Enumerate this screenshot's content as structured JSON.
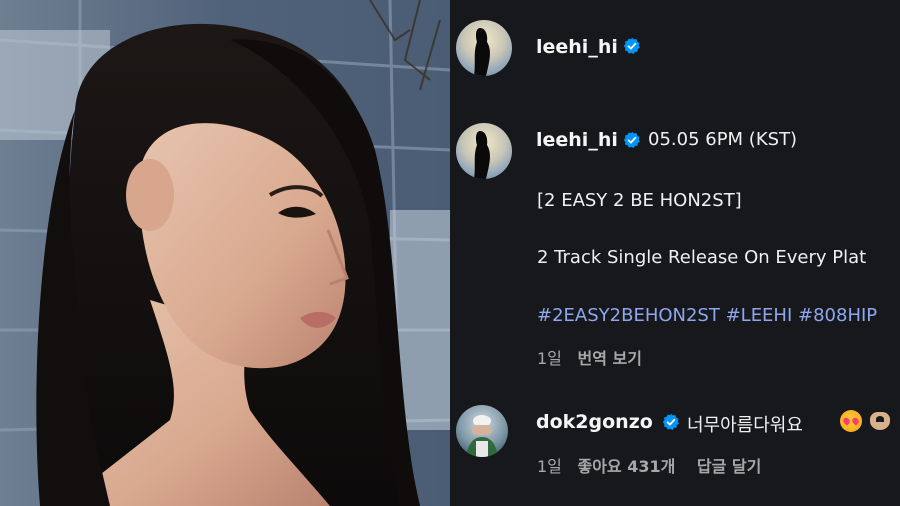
{
  "post": {
    "author": "leehi_hi",
    "caption_author": "leehi_hi",
    "release_info": "05.05 6PM (KST)",
    "title_line": "[2 EASY 2 BE HON2ST]",
    "description": "2 Track Single Release On Every Plat",
    "hashtags": "#2EASY2BEHON2ST #LEEHI #808HIP",
    "time_ago": "1일",
    "translate_label": "번역 보기"
  },
  "comment": {
    "author": "dok2gonzo",
    "text": "너무아름다워요",
    "time_ago": "1일",
    "likes_label": "좋아요 431개",
    "reply_label": "답글 달기"
  },
  "icons": {
    "verified": "verified-badge-icon",
    "emoji1": "heart-eyes-emoji-icon",
    "emoji2": "heart-hands-emoji-icon"
  },
  "colors": {
    "panel_bg": "#16181c",
    "verified_blue": "#0095f6",
    "hashtag_blue": "#8ea7f0",
    "meta_gray": "#a8a8a8"
  }
}
